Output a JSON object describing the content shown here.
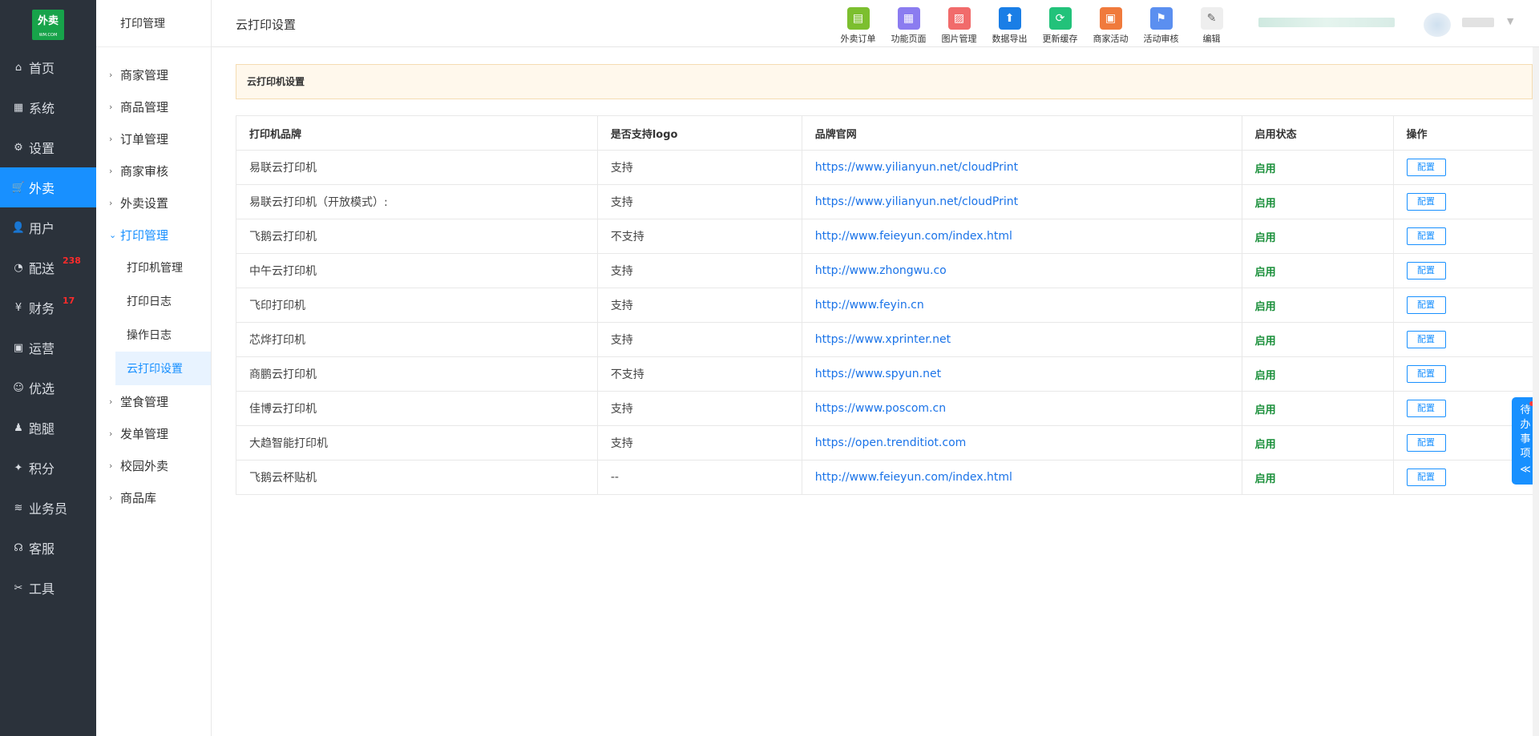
{
  "logo": {
    "text": "外卖",
    "subtext": "WM.COM"
  },
  "nav": [
    {
      "label": "首页",
      "icon": "home-icon",
      "glyph": "⌂"
    },
    {
      "label": "系统",
      "icon": "windows-icon",
      "glyph": "▦"
    },
    {
      "label": "设置",
      "icon": "gear-icon",
      "glyph": "⚙"
    },
    {
      "label": "外卖",
      "icon": "cart-icon",
      "glyph": "🛒",
      "active": true
    },
    {
      "label": "用户",
      "icon": "user-icon",
      "glyph": "👤"
    },
    {
      "label": "配送",
      "icon": "dashboard-icon",
      "glyph": "◔",
      "badge": "238"
    },
    {
      "label": "财务",
      "icon": "yen-icon",
      "glyph": "¥",
      "badge": "17"
    },
    {
      "label": "运营",
      "icon": "gift-icon",
      "glyph": "▣"
    },
    {
      "label": "优选",
      "icon": "smile-icon",
      "glyph": "☺"
    },
    {
      "label": "跑腿",
      "icon": "person-icon",
      "glyph": "♟"
    },
    {
      "label": "积分",
      "icon": "points-icon",
      "glyph": "✦"
    },
    {
      "label": "业务员",
      "icon": "layers-icon",
      "glyph": "≋"
    },
    {
      "label": "客服",
      "icon": "headset-icon",
      "glyph": "☊"
    },
    {
      "label": "工具",
      "icon": "tools-icon",
      "glyph": "✂"
    }
  ],
  "subbar": {
    "title": "打印管理",
    "items": [
      "商家管理",
      "商品管理",
      "订单管理",
      "商家审核",
      "外卖设置"
    ],
    "open_item": "打印管理",
    "children": [
      "打印机管理",
      "打印日志",
      "操作日志",
      "云打印设置"
    ],
    "items_after": [
      "堂食管理",
      "发单管理",
      "校园外卖",
      "商品库"
    ]
  },
  "header": {
    "title": "云打印设置",
    "tools": [
      {
        "label": "外卖订单",
        "icon": "clipboard-icon",
        "glyph": "▤",
        "color": "#7cbf2f"
      },
      {
        "label": "功能页面",
        "icon": "grid-icon",
        "glyph": "▦",
        "color": "#8b7cf0"
      },
      {
        "label": "图片管理",
        "icon": "image-icon",
        "glyph": "▨",
        "color": "#f16b6b"
      },
      {
        "label": "数据导出",
        "icon": "upload-icon",
        "glyph": "⬆",
        "color": "#1a7ee6"
      },
      {
        "label": "更新缓存",
        "icon": "refresh-icon",
        "glyph": "⟳",
        "color": "#22c27a"
      },
      {
        "label": "商家活动",
        "icon": "gift-icon",
        "glyph": "▣",
        "color": "#f07a3c"
      },
      {
        "label": "活动审核",
        "icon": "flag-check-icon",
        "glyph": "⚑",
        "color": "#5b8ff0"
      },
      {
        "label": "编辑",
        "icon": "pencil-icon",
        "glyph": "✎",
        "color": "#eeeeee"
      }
    ]
  },
  "notice": "云打印机设置",
  "table": {
    "headers": [
      "打印机品牌",
      "是否支持logo",
      "品牌官网",
      "启用状态",
      "操作"
    ],
    "rows": [
      {
        "brand": "易联云打印机",
        "logo": "支持",
        "url": "https://www.yilianyun.net/cloudPrint",
        "status": "启用",
        "action": "配置"
      },
      {
        "brand": "易联云打印机（开放模式）:",
        "logo": "支持",
        "url": "https://www.yilianyun.net/cloudPrint",
        "status": "启用",
        "action": "配置"
      },
      {
        "brand": "飞鹅云打印机",
        "logo": "不支持",
        "url": "http://www.feieyun.com/index.html",
        "status": "启用",
        "action": "配置"
      },
      {
        "brand": "中午云打印机",
        "logo": "支持",
        "url": "http://www.zhongwu.co",
        "status": "启用",
        "action": "配置"
      },
      {
        "brand": "飞印打印机",
        "logo": "支持",
        "url": "http://www.feyin.cn",
        "status": "启用",
        "action": "配置"
      },
      {
        "brand": "芯烨打印机",
        "logo": "支持",
        "url": "https://www.xprinter.net",
        "status": "启用",
        "action": "配置"
      },
      {
        "brand": "商鹏云打印机",
        "logo": "不支持",
        "url": "https://www.spyun.net",
        "status": "启用",
        "action": "配置"
      },
      {
        "brand": "佳博云打印机",
        "logo": "支持",
        "url": "https://www.poscom.cn",
        "status": "启用",
        "action": "配置"
      },
      {
        "brand": "大趋智能打印机",
        "logo": "支持",
        "url": "https://open.trenditiot.com",
        "status": "启用",
        "action": "配置"
      },
      {
        "brand": "飞鹅云杯贴机",
        "logo": "--",
        "url": "http://www.feieyun.com/index.html",
        "status": "启用",
        "action": "配置"
      }
    ]
  },
  "todo_tab": {
    "chars": [
      "待",
      "办",
      "事",
      "项"
    ],
    "icon": "double-chevron-left-icon",
    "glyph": "≪"
  }
}
